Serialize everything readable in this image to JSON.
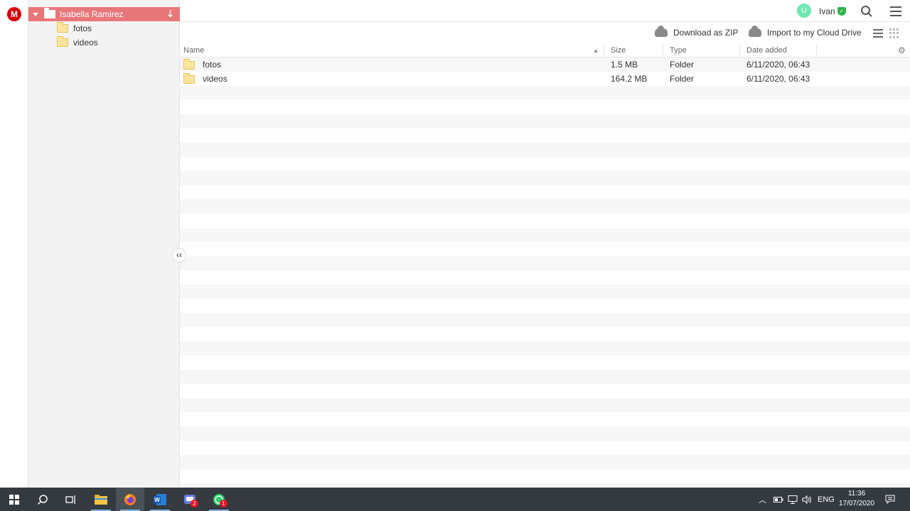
{
  "app": {
    "logo_letter": "M"
  },
  "tree": {
    "root_label": "Isabella Ramirez",
    "children": [
      {
        "label": "fotos"
      },
      {
        "label": "videos"
      }
    ]
  },
  "topbar": {
    "avatar_initial": "U",
    "username": "Ivan"
  },
  "toolbar": {
    "download_label": "Download as ZIP",
    "import_label": "Import to my Cloud Drive"
  },
  "table": {
    "headers": {
      "name": "Name",
      "size": "Size",
      "type": "Type",
      "date": "Date added"
    },
    "rows": [
      {
        "name": "fotos",
        "size": "1.5 MB",
        "type": "Folder",
        "date": "6/11/2020, 06:43"
      },
      {
        "name": "videos",
        "size": "164.2 MB",
        "type": "Folder",
        "date": "6/11/2020, 06:43"
      }
    ]
  },
  "taskbar": {
    "badges": {
      "teams": "2",
      "whatsapp": "1"
    },
    "language": "ENG",
    "time": "11:36",
    "date": "17/07/2020"
  },
  "colors": {
    "accent_tree_root": "#e8777a",
    "brand": "#d90007",
    "avatar": "#6fe7b2"
  }
}
